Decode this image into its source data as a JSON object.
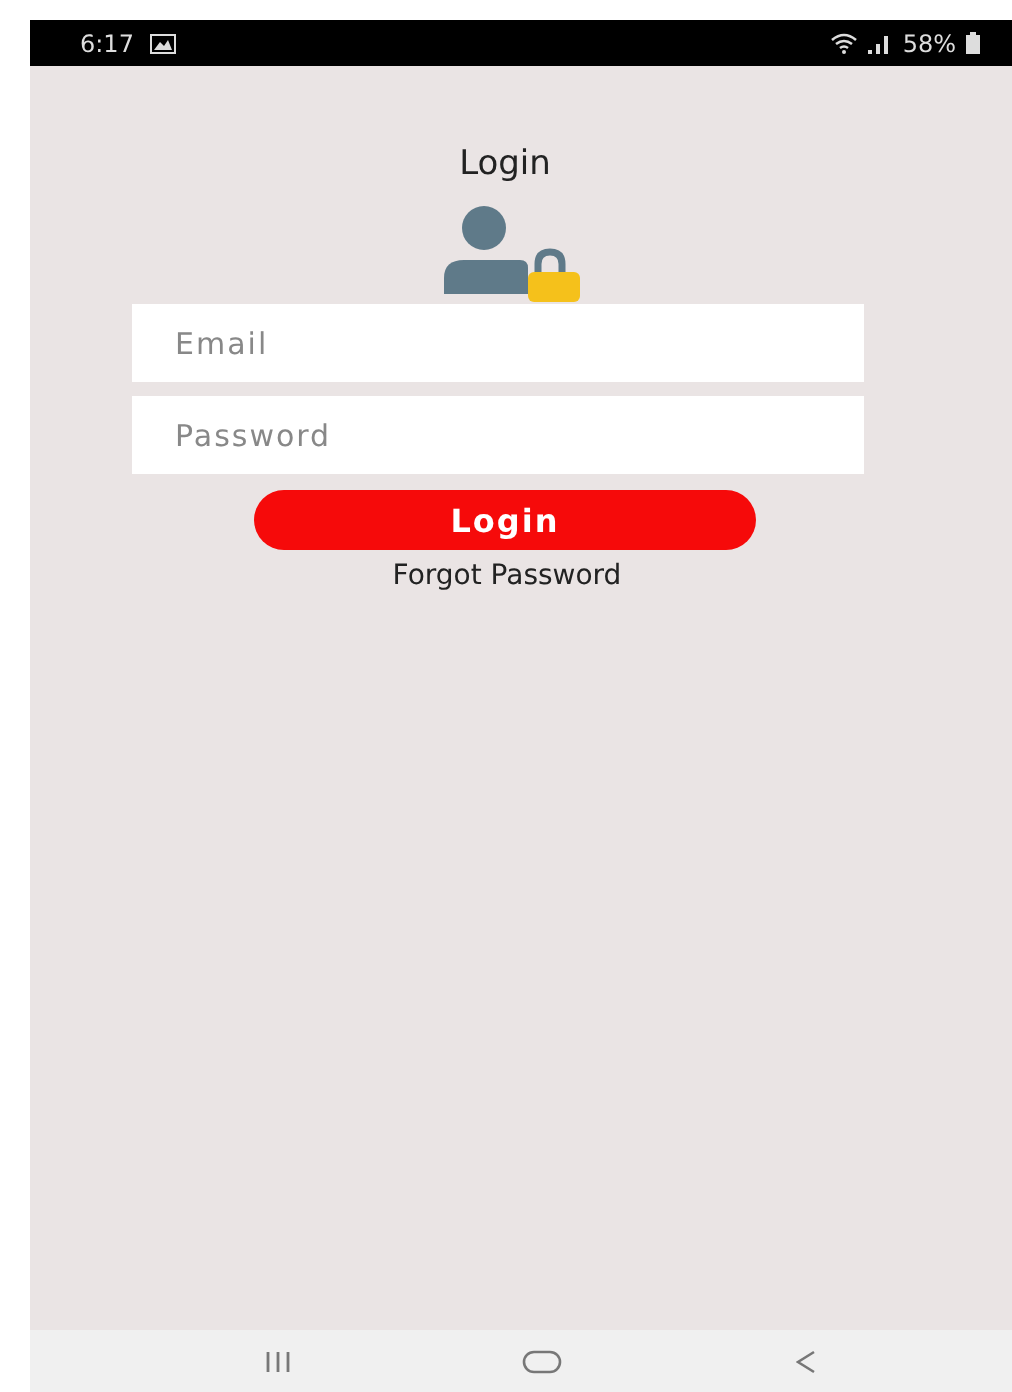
{
  "status_bar": {
    "time": "6:17",
    "battery": "58%"
  },
  "title": "Login",
  "fields": [
    {
      "placeholder": "Email"
    },
    {
      "placeholder": "Password"
    }
  ],
  "login_button": "Login",
  "forgot_link": "Forgot Password"
}
